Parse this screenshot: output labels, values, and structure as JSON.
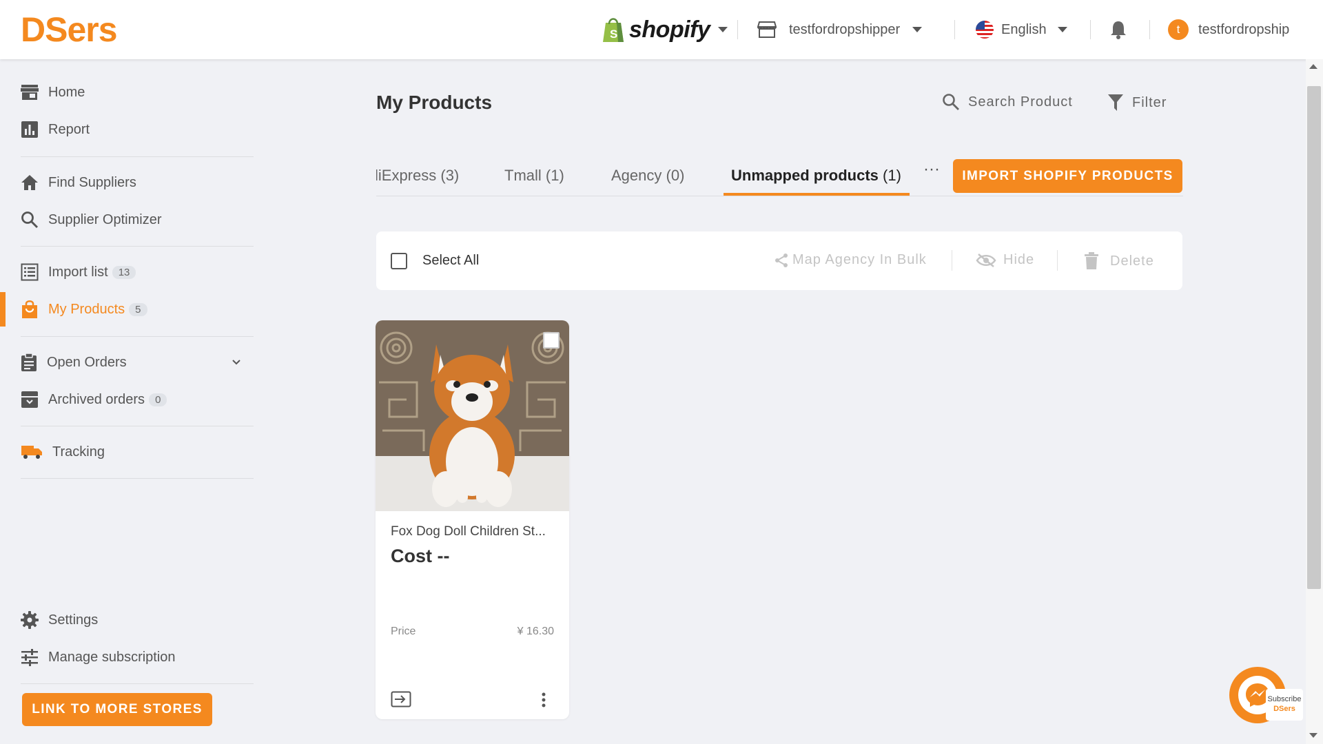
{
  "header": {
    "logo": "DSers",
    "platform": "shopify",
    "store": "testfordropshipper",
    "language": "English",
    "user": "testfordropship",
    "user_initial": "t"
  },
  "sidebar": {
    "items": [
      {
        "label": "Home",
        "icon": "storefront-icon"
      },
      {
        "label": "Report",
        "icon": "bar-chart-icon"
      },
      {
        "label": "Find Suppliers",
        "icon": "house-icon"
      },
      {
        "label": "Supplier Optimizer",
        "icon": "search-icon"
      },
      {
        "label": "Import list",
        "badge": "13",
        "icon": "list-icon"
      },
      {
        "label": "My Products",
        "badge": "5",
        "icon": "shopping-bag-icon",
        "active": true
      },
      {
        "label": "Open Orders",
        "icon": "clipboard-icon"
      },
      {
        "label": "Archived orders",
        "badge": "0",
        "icon": "archive-box-icon"
      },
      {
        "label": "Tracking",
        "icon": "truck-icon"
      },
      {
        "label": "Settings",
        "icon": "gear-icon"
      },
      {
        "label": "Manage subscription",
        "icon": "sliders-icon"
      }
    ],
    "link_button": "LINK TO MORE STORES"
  },
  "main": {
    "title": "My Products",
    "search_label": "Search Product",
    "filter_label": "Filter",
    "tabs": [
      {
        "label": "liExpress",
        "count": "(3)"
      },
      {
        "label": "Tmall",
        "count": "(1)"
      },
      {
        "label": "Agency",
        "count": "(0)"
      },
      {
        "label": "Unmapped products",
        "count": "(1)",
        "active": true
      }
    ],
    "tabs_more": "···",
    "import_button": "IMPORT SHOPIFY PRODUCTS",
    "bulk": {
      "select_all": "Select All",
      "map_agency": "Map Agency In Bulk",
      "hide": "Hide",
      "delete": "Delete"
    },
    "product": {
      "name": "Fox Dog Doll Children St...",
      "cost": "Cost --",
      "price_label": "Price",
      "price": "¥ 16.30"
    }
  },
  "widget": {
    "subscribe": "Subscribe",
    "brand": "DSers"
  },
  "colors": {
    "accent": "#f4891f",
    "background": "#f0f1f5"
  }
}
